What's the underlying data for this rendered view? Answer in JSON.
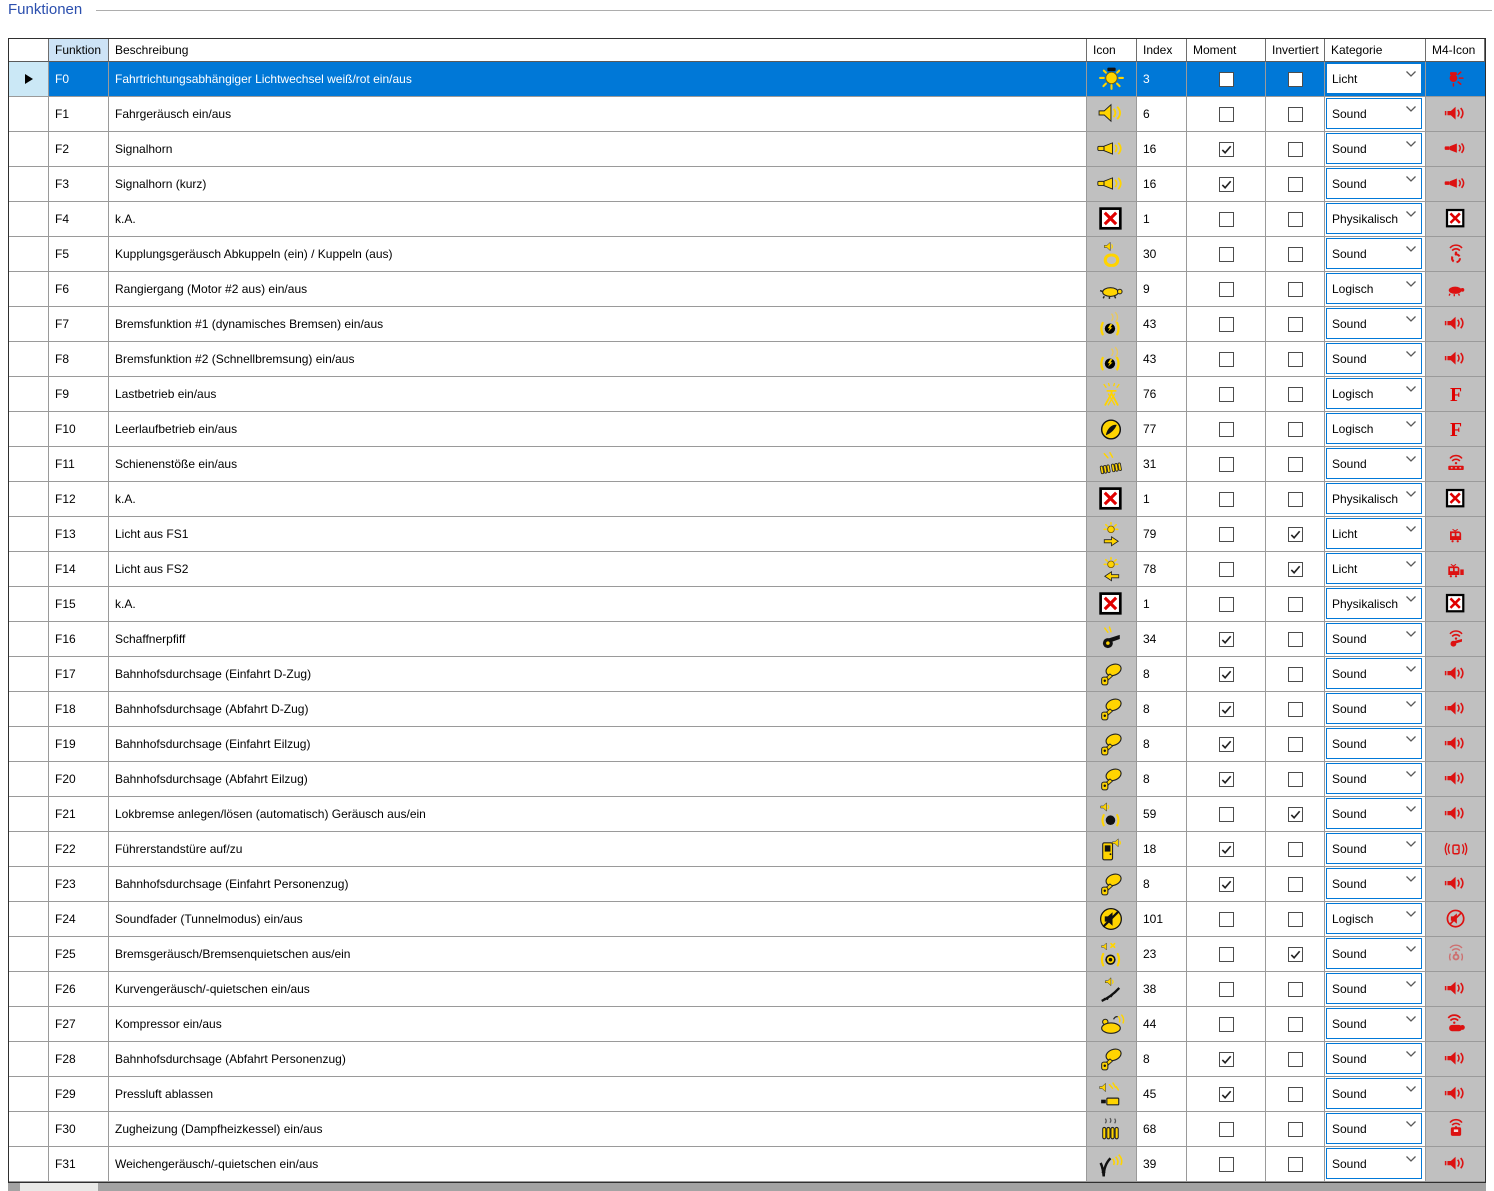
{
  "title": "Funktionen",
  "colors": {
    "accent": "#0078d7",
    "selected_text": "#ffffff",
    "header_highlight": "#cde3f6",
    "row_selector_selected": "#cbe8f6",
    "icon_column_bg": "#c0c0c0",
    "grid_line": "#9a9a9a",
    "table_border": "#2f2f2f",
    "title_blue": "#2b4fae",
    "icon_yellow": "#ffd400",
    "m4_red": "#dd1111",
    "scroll_track": "#a3a3a3",
    "scroll_thumb": "#e9e9e7"
  },
  "table": {
    "columns": {
      "selector": "",
      "funktion": "Funktion",
      "beschreibung": "Beschreibung",
      "icon": "Icon",
      "index": "Index",
      "moment": "Moment",
      "invertiert": "Invertiert",
      "kategorie": "Kategorie",
      "m4_icon": "M4-Icon"
    },
    "kategorie_options_visible": [
      "Licht",
      "Sound",
      "Physikalisch",
      "Logisch"
    ],
    "rows": [
      {
        "funktion": "F0",
        "beschreibung": "Fahrtrichtungsabhängiger Lichtwechsel weiß/rot ein/aus",
        "icon": "light-sun",
        "index": "3",
        "moment": false,
        "invertiert": false,
        "kategorie": "Licht",
        "m4_icon": "m4-light",
        "selected": true
      },
      {
        "funktion": "F1",
        "beschreibung": "Fahrgeräusch ein/aus",
        "icon": "speaker-waves",
        "index": "6",
        "moment": false,
        "invertiert": false,
        "kategorie": "Sound",
        "m4_icon": "m4-speaker",
        "selected": false
      },
      {
        "funktion": "F2",
        "beschreibung": "Signalhorn",
        "icon": "horn-waves",
        "index": "16",
        "moment": true,
        "invertiert": false,
        "kategorie": "Sound",
        "m4_icon": "m4-horn",
        "selected": false
      },
      {
        "funktion": "F3",
        "beschreibung": "Signalhorn (kurz)",
        "icon": "horn-waves",
        "index": "16",
        "moment": true,
        "invertiert": false,
        "kategorie": "Sound",
        "m4_icon": "m4-horn",
        "selected": false
      },
      {
        "funktion": "F4",
        "beschreibung": "k.A.",
        "icon": "not-assigned-x",
        "index": "1",
        "moment": false,
        "invertiert": false,
        "kategorie": "Physikalisch",
        "m4_icon": "m4-x",
        "selected": false
      },
      {
        "funktion": "F5",
        "beschreibung": "Kupplungsgeräusch Abkuppeln (ein) / Kuppeln (aus)",
        "icon": "coupler-sound",
        "index": "30",
        "moment": false,
        "invertiert": false,
        "kategorie": "Sound",
        "m4_icon": "m4-coupler-waves",
        "selected": false
      },
      {
        "funktion": "F6",
        "beschreibung": "Rangiergang (Motor #2 aus) ein/aus",
        "icon": "shunting-turtle",
        "index": "9",
        "moment": false,
        "invertiert": false,
        "kategorie": "Logisch",
        "m4_icon": "m4-turtle",
        "selected": false
      },
      {
        "funktion": "F7",
        "beschreibung": "Bremsfunktion #1 (dynamisches Bremsen) ein/aus",
        "icon": "brake-sound",
        "index": "43",
        "moment": false,
        "invertiert": false,
        "kategorie": "Sound",
        "m4_icon": "m4-speaker",
        "selected": false
      },
      {
        "funktion": "F8",
        "beschreibung": "Bremsfunktion #2 (Schnellbremsung) ein/aus",
        "icon": "brake-sound",
        "index": "43",
        "moment": false,
        "invertiert": false,
        "kategorie": "Sound",
        "m4_icon": "m4-speaker",
        "selected": false
      },
      {
        "funktion": "F9",
        "beschreibung": "Lastbetrieb ein/aus",
        "icon": "pantograph",
        "index": "76",
        "moment": false,
        "invertiert": false,
        "kategorie": "Logisch",
        "m4_icon": "m4-letter-f",
        "selected": false
      },
      {
        "funktion": "F10",
        "beschreibung": "Leerlaufbetrieb ein/aus",
        "icon": "idle-gauge",
        "index": "77",
        "moment": false,
        "invertiert": false,
        "kategorie": "Logisch",
        "m4_icon": "m4-letter-f",
        "selected": false
      },
      {
        "funktion": "F11",
        "beschreibung": "Schienenstöße ein/aus",
        "icon": "rail-joints",
        "index": "31",
        "moment": false,
        "invertiert": false,
        "kategorie": "Sound",
        "m4_icon": "m4-rail-waves",
        "selected": false
      },
      {
        "funktion": "F12",
        "beschreibung": "k.A.",
        "icon": "not-assigned-x",
        "index": "1",
        "moment": false,
        "invertiert": false,
        "kategorie": "Physikalisch",
        "m4_icon": "m4-x",
        "selected": false
      },
      {
        "funktion": "F13",
        "beschreibung": "Licht aus FS1",
        "icon": "light-arrow-right",
        "index": "79",
        "moment": false,
        "invertiert": true,
        "kategorie": "Licht",
        "m4_icon": "m4-loco-a",
        "selected": false
      },
      {
        "funktion": "F14",
        "beschreibung": "Licht aus FS2",
        "icon": "light-arrow-left",
        "index": "78",
        "moment": false,
        "invertiert": true,
        "kategorie": "Licht",
        "m4_icon": "m4-loco-b",
        "selected": false
      },
      {
        "funktion": "F15",
        "beschreibung": "k.A.",
        "icon": "not-assigned-x",
        "index": "1",
        "moment": false,
        "invertiert": false,
        "kategorie": "Physikalisch",
        "m4_icon": "m4-x",
        "selected": false
      },
      {
        "funktion": "F16",
        "beschreibung": "Schaffnerpfiff",
        "icon": "conductor-whistle",
        "index": "34",
        "moment": true,
        "invertiert": false,
        "kategorie": "Sound",
        "m4_icon": "m4-whistle-waves",
        "selected": false
      },
      {
        "funktion": "F17",
        "beschreibung": "Bahnhofsdurchsage (Einfahrt D-Zug)",
        "icon": "announcement-megaphone",
        "index": "8",
        "moment": true,
        "invertiert": false,
        "kategorie": "Sound",
        "m4_icon": "m4-speaker",
        "selected": false
      },
      {
        "funktion": "F18",
        "beschreibung": "Bahnhofsdurchsage (Abfahrt D-Zug)",
        "icon": "announcement-megaphone",
        "index": "8",
        "moment": true,
        "invertiert": false,
        "kategorie": "Sound",
        "m4_icon": "m4-speaker",
        "selected": false
      },
      {
        "funktion": "F19",
        "beschreibung": "Bahnhofsdurchsage (Einfahrt Eilzug)",
        "icon": "announcement-megaphone",
        "index": "8",
        "moment": true,
        "invertiert": false,
        "kategorie": "Sound",
        "m4_icon": "m4-speaker",
        "selected": false
      },
      {
        "funktion": "F20",
        "beschreibung": "Bahnhofsdurchsage (Abfahrt Eilzug)",
        "icon": "announcement-megaphone",
        "index": "8",
        "moment": true,
        "invertiert": false,
        "kategorie": "Sound",
        "m4_icon": "m4-speaker",
        "selected": false
      },
      {
        "funktion": "F21",
        "beschreibung": "Lokbremse anlegen/lösen (automatisch) Geräusch aus/ein",
        "icon": "brake-speaker",
        "index": "59",
        "moment": false,
        "invertiert": true,
        "kategorie": "Sound",
        "m4_icon": "m4-speaker",
        "selected": false
      },
      {
        "funktion": "F22",
        "beschreibung": "Führerstandstüre auf/zu",
        "icon": "cab-door-sound",
        "index": "18",
        "moment": true,
        "invertiert": false,
        "kategorie": "Sound",
        "m4_icon": "m4-door-waves",
        "selected": false
      },
      {
        "funktion": "F23",
        "beschreibung": "Bahnhofsdurchsage (Einfahrt Personenzug)",
        "icon": "announcement-megaphone",
        "index": "8",
        "moment": true,
        "invertiert": false,
        "kategorie": "Sound",
        "m4_icon": "m4-speaker",
        "selected": false
      },
      {
        "funktion": "F24",
        "beschreibung": "Soundfader (Tunnelmodus) ein/aus",
        "icon": "sound-mute",
        "index": "101",
        "moment": false,
        "invertiert": false,
        "kategorie": "Logisch",
        "m4_icon": "m4-mute",
        "selected": false
      },
      {
        "funktion": "F25",
        "beschreibung": "Bremsgeräusch/Bremsenquietschen aus/ein",
        "icon": "brake-squeal-off",
        "index": "23",
        "moment": false,
        "invertiert": true,
        "kategorie": "Sound",
        "m4_icon": "m4-brake-faded",
        "selected": false
      },
      {
        "funktion": "F26",
        "beschreibung": "Kurvengeräusch/-quietschen ein/aus",
        "icon": "curve-squeal",
        "index": "38",
        "moment": false,
        "invertiert": false,
        "kategorie": "Sound",
        "m4_icon": "m4-speaker",
        "selected": false
      },
      {
        "funktion": "F27",
        "beschreibung": "Kompressor ein/aus",
        "icon": "compressor",
        "index": "44",
        "moment": false,
        "invertiert": false,
        "kategorie": "Sound",
        "m4_icon": "m4-compressor-waves",
        "selected": false
      },
      {
        "funktion": "F28",
        "beschreibung": "Bahnhofsdurchsage (Abfahrt Personenzug)",
        "icon": "announcement-megaphone",
        "index": "8",
        "moment": true,
        "invertiert": false,
        "kategorie": "Sound",
        "m4_icon": "m4-speaker",
        "selected": false
      },
      {
        "funktion": "F29",
        "beschreibung": "Pressluft ablassen",
        "icon": "air-release",
        "index": "45",
        "moment": true,
        "invertiert": false,
        "kategorie": "Sound",
        "m4_icon": "m4-speaker",
        "selected": false
      },
      {
        "funktion": "F30",
        "beschreibung": "Zugheizung (Dampfheizkessel) ein/aus",
        "icon": "train-heating",
        "index": "68",
        "moment": false,
        "invertiert": false,
        "kategorie": "Sound",
        "m4_icon": "m4-heater-loco",
        "selected": false
      },
      {
        "funktion": "F31",
        "beschreibung": "Weichengeräusch/-quietschen ein/aus",
        "icon": "turnout-sound",
        "index": "39",
        "moment": false,
        "invertiert": false,
        "kategorie": "Sound",
        "m4_icon": "m4-speaker",
        "selected": false
      }
    ]
  }
}
